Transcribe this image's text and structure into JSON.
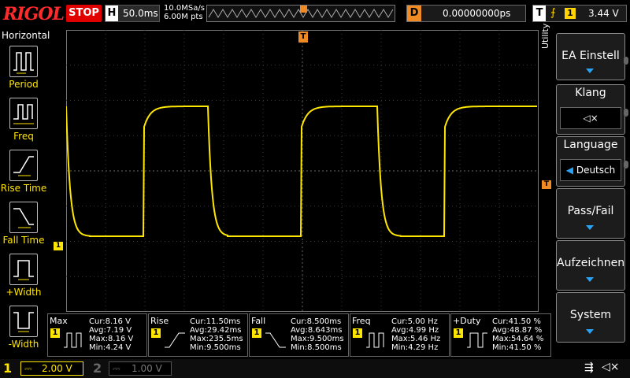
{
  "header": {
    "logo": "RIGOL",
    "run_state": "STOP",
    "timebase_label": "H",
    "timebase_value": "50.0ms",
    "sample_rate": "10.0MSa/s",
    "memory_depth": "6.00M pts",
    "delay_label": "D",
    "delay_value": "0.00000000ps",
    "trigger_label": "T",
    "trigger_edge_icon": "rising-edge-icon",
    "trigger_channel": "1",
    "trigger_level": "3.44 V"
  },
  "left_menu": {
    "title": "Horizontal",
    "items": [
      {
        "label": "Period",
        "icon": "period-icon"
      },
      {
        "label": "Freq",
        "icon": "frequency-icon"
      },
      {
        "label": "Rise Time",
        "icon": "rise-time-icon"
      },
      {
        "label": "Fall Time",
        "icon": "fall-time-icon"
      },
      {
        "label": "+Width",
        "icon": "positive-width-icon"
      },
      {
        "label": "-Width",
        "icon": "negative-width-icon"
      }
    ]
  },
  "right_menu": {
    "side_label": "Utility",
    "items": [
      {
        "label": "EA Einstell",
        "has_arrow": true
      },
      {
        "label": "Klang",
        "value_icon": "speaker-muted-icon",
        "value": "◁×"
      },
      {
        "label": "Language",
        "value": "Deutsch"
      },
      {
        "label": "Pass/Fail",
        "has_arrow": true
      },
      {
        "label": "Aufzeichnen",
        "has_arrow": true
      },
      {
        "label": "System",
        "has_arrow": true
      }
    ]
  },
  "measurements": [
    {
      "name": "Max",
      "channel": "1",
      "cur": "Cur:8.16 V",
      "avg": "Avg:7.19 V",
      "max": "Max:8.16 V",
      "min": "Min:4.24 V"
    },
    {
      "name": "Rise",
      "channel": "1",
      "cur": "Cur:11.50ms",
      "avg": "Avg:29.42ms",
      "max": "Max:235.5ms",
      "min": "Min:9.500ms"
    },
    {
      "name": "Fall",
      "channel": "1",
      "cur": "Cur:8.500ms",
      "avg": "Avg:8.643ms",
      "max": "Max:9.500ms",
      "min": "Min:8.500ms"
    },
    {
      "name": "Freq",
      "channel": "1",
      "cur": "Cur:5.00 Hz",
      "avg": "Avg:4.99 Hz",
      "max": "Max:5.46 Hz",
      "min": "Min:4.29 Hz"
    },
    {
      "name": "+Duty",
      "channel": "1",
      "cur": "Cur:41.50 %",
      "avg": "Avg:48.87 %",
      "max": "Max:54.64 %",
      "min": "Min:41.50 %"
    }
  ],
  "channels": [
    {
      "number": "1",
      "scale": "2.00 V",
      "color": "#ffe600",
      "active": true
    },
    {
      "number": "2",
      "scale": "1.00 V",
      "color": "#6a6a6a",
      "active": false
    }
  ],
  "markers": {
    "ch1_ground_marker": "1",
    "trigger_position_marker": "T",
    "trigger_level_marker": "T"
  },
  "status_icons": [
    "usb-icon",
    "speaker-muted-icon"
  ],
  "colors": {
    "trace": "#ffe600",
    "trigger": "#f08a24",
    "accent_arrow": "#2ba3f5",
    "stop": "#e00000"
  }
}
